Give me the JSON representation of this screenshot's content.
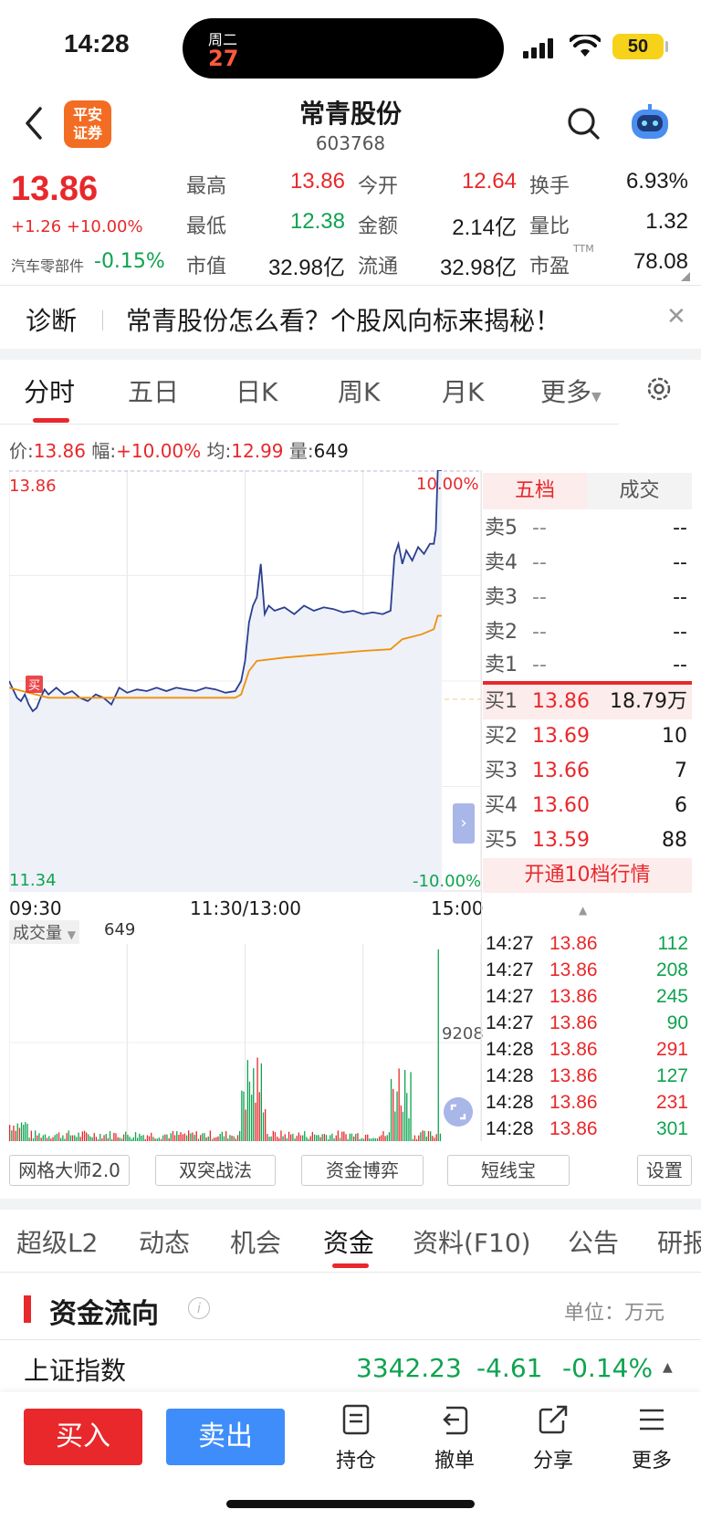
{
  "status_bar": {
    "time": "14:28",
    "island_day": "周二",
    "island_date": "27",
    "battery": "50"
  },
  "header": {
    "logo_line1": "平安",
    "logo_line2": "证券",
    "stock_name": "常青股份",
    "stock_code": "603768"
  },
  "quote": {
    "price": "13.86",
    "change": "+1.26 +10.00%",
    "sector_name": "汽车零部件",
    "sector_change": "-0.15%",
    "rows": [
      {
        "l1": "最高",
        "v1": "13.86",
        "l2": "今开",
        "v2": "12.64",
        "l3": "换手",
        "v3": "6.93%"
      },
      {
        "l1": "最低",
        "v1": "12.38",
        "l2": "金额",
        "v2": "2.14亿",
        "l3": "量比",
        "v3": "1.32"
      },
      {
        "l1": "市值",
        "v1": "32.98亿",
        "l2": "流通",
        "v2": "32.98亿",
        "l3": "市盈",
        "v3": "78.08"
      }
    ],
    "ttm": "TTM"
  },
  "diagnosis": {
    "label": "诊断",
    "text": "常青股份怎么看？个股风向标来揭秘！"
  },
  "chart_tabs": [
    "分时",
    "五日",
    "日K",
    "周K",
    "月K",
    "更多"
  ],
  "infobar": {
    "price_label": "价:",
    "price": "13.86",
    "range_label": "幅:",
    "range": "+10.00%",
    "avg_label": "均:",
    "avg": "12.99",
    "vol_label": "量:",
    "vol": "649"
  },
  "chart_labels": {
    "y_top": "13.86",
    "y_bottom": "11.34",
    "pct_top": "10.00%",
    "pct_bottom": "-10.00%",
    "marker": "买",
    "t_start": "09:30",
    "t_mid": "11:30/13:00",
    "t_end": "15:00"
  },
  "volume": {
    "label": "成交量",
    "value": "649",
    "max_label": "9208"
  },
  "chart_data": {
    "type": "line",
    "x_range": [
      "09:30",
      "15:00"
    ],
    "ylim": [
      11.34,
      13.86
    ],
    "price_series": [
      [
        0,
        12.6
      ],
      [
        2,
        12.55
      ],
      [
        4,
        12.5
      ],
      [
        6,
        12.48
      ],
      [
        8,
        12.52
      ],
      [
        10,
        12.46
      ],
      [
        12,
        12.42
      ],
      [
        14,
        12.44
      ],
      [
        16,
        12.5
      ],
      [
        18,
        12.55
      ],
      [
        20,
        12.52
      ],
      [
        24,
        12.56
      ],
      [
        28,
        12.52
      ],
      [
        32,
        12.54
      ],
      [
        36,
        12.5
      ],
      [
        40,
        12.48
      ],
      [
        44,
        12.52
      ],
      [
        48,
        12.5
      ],
      [
        52,
        12.46
      ],
      [
        56,
        12.56
      ],
      [
        60,
        12.53
      ],
      [
        65,
        12.55
      ],
      [
        70,
        12.54
      ],
      [
        75,
        12.56
      ],
      [
        80,
        12.54
      ],
      [
        85,
        12.56
      ],
      [
        90,
        12.55
      ],
      [
        95,
        12.54
      ],
      [
        100,
        12.56
      ],
      [
        105,
        12.55
      ],
      [
        110,
        12.53
      ],
      [
        115,
        12.54
      ],
      [
        118,
        12.6
      ],
      [
        120,
        12.72
      ],
      [
        122,
        12.95
      ],
      [
        124,
        13.05
      ],
      [
        126,
        13.1
      ],
      [
        128,
        13.3
      ],
      [
        130,
        13.0
      ],
      [
        132,
        13.05
      ],
      [
        135,
        13.02
      ],
      [
        140,
        13.04
      ],
      [
        145,
        13.0
      ],
      [
        150,
        13.05
      ],
      [
        155,
        13.02
      ],
      [
        160,
        13.04
      ],
      [
        165,
        13.03
      ],
      [
        170,
        13.01
      ],
      [
        175,
        13.02
      ],
      [
        180,
        13.0
      ],
      [
        185,
        13.01
      ],
      [
        190,
        13.0
      ],
      [
        194,
        13.02
      ],
      [
        196,
        13.35
      ],
      [
        198,
        13.42
      ],
      [
        200,
        13.3
      ],
      [
        202,
        13.38
      ],
      [
        205,
        13.32
      ],
      [
        208,
        13.4
      ],
      [
        211,
        13.36
      ],
      [
        214,
        13.42
      ],
      [
        216,
        13.42
      ],
      [
        217,
        13.5
      ],
      [
        218,
        13.86
      ],
      [
        220,
        13.86
      ]
    ],
    "avg_series": [
      [
        0,
        12.56
      ],
      [
        20,
        12.5
      ],
      [
        40,
        12.5
      ],
      [
        60,
        12.5
      ],
      [
        80,
        12.5
      ],
      [
        100,
        12.5
      ],
      [
        115,
        12.5
      ],
      [
        118,
        12.52
      ],
      [
        122,
        12.66
      ],
      [
        126,
        12.72
      ],
      [
        140,
        12.74
      ],
      [
        160,
        12.76
      ],
      [
        180,
        12.78
      ],
      [
        194,
        12.79
      ],
      [
        200,
        12.85
      ],
      [
        210,
        12.88
      ],
      [
        216,
        12.91
      ],
      [
        218,
        12.99
      ],
      [
        220,
        12.99
      ]
    ],
    "volume_max": 9208
  },
  "order_book": {
    "tabs": [
      "五档",
      "成交"
    ],
    "sells": [
      {
        "n": "卖5",
        "p": "--",
        "v": "--"
      },
      {
        "n": "卖4",
        "p": "--",
        "v": "--"
      },
      {
        "n": "卖3",
        "p": "--",
        "v": "--"
      },
      {
        "n": "卖2",
        "p": "--",
        "v": "--"
      },
      {
        "n": "卖1",
        "p": "--",
        "v": "--"
      }
    ],
    "buys": [
      {
        "n": "买1",
        "p": "13.86",
        "v": "18.79万"
      },
      {
        "n": "买2",
        "p": "13.69",
        "v": "10"
      },
      {
        "n": "买3",
        "p": "13.66",
        "v": "7"
      },
      {
        "n": "买4",
        "p": "13.60",
        "v": "6"
      },
      {
        "n": "买5",
        "p": "13.59",
        "v": "88"
      }
    ],
    "open_level10": "开通10档行情",
    "ticks": [
      {
        "t": "14:27",
        "p": "13.86",
        "v": "112",
        "c": "green"
      },
      {
        "t": "14:27",
        "p": "13.86",
        "v": "208",
        "c": "green"
      },
      {
        "t": "14:27",
        "p": "13.86",
        "v": "245",
        "c": "green"
      },
      {
        "t": "14:27",
        "p": "13.86",
        "v": "90",
        "c": "green"
      },
      {
        "t": "14:28",
        "p": "13.86",
        "v": "291",
        "c": "red"
      },
      {
        "t": "14:28",
        "p": "13.86",
        "v": "127",
        "c": "green"
      },
      {
        "t": "14:28",
        "p": "13.86",
        "v": "231",
        "c": "red"
      },
      {
        "t": "14:28",
        "p": "13.86",
        "v": "301",
        "c": "green"
      }
    ]
  },
  "tools": [
    "网格大师2.0",
    "双突战法",
    "资金博弈",
    "短线宝",
    "设置"
  ],
  "lower_tabs": [
    "超级L2",
    "动态",
    "机会",
    "资金",
    "资料(F10)",
    "公告",
    "研报"
  ],
  "fund_flow": {
    "title": "资金流向",
    "unit": "单位：万元"
  },
  "index_row": {
    "name": "上证指数",
    "price": "3342.23",
    "change": "-4.61",
    "pct": "-0.14%"
  },
  "bottom_bar": {
    "buy": "买入",
    "sell": "卖出",
    "holdings": "持仓",
    "cancel": "撤单",
    "share": "分享",
    "more": "更多"
  },
  "colors": {
    "up": "#e8282b",
    "down": "#0fa350",
    "price_line": "#2b3f8f",
    "avg_line": "#f0900a",
    "sell_btn": "#3e8dfa"
  }
}
